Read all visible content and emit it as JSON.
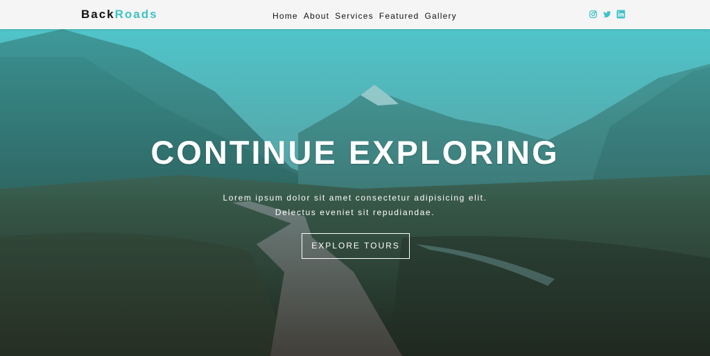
{
  "colors": {
    "accent": "#3ec1c8",
    "navbar_bg": "#f5f5f5",
    "text_dark": "#111111",
    "hero_text": "#ffffff"
  },
  "navbar": {
    "logo_part1": "Back",
    "logo_part2": "Roads",
    "links": [
      "Home",
      "About",
      "Services",
      "Featured",
      "Gallery"
    ],
    "social_icons": [
      "instagram-icon",
      "twitter-icon",
      "linkedin-icon"
    ]
  },
  "hero": {
    "title": "CONTINUE EXPLORING",
    "text_line1": "Lorem ipsum dolor sit amet consectetur adipisicing elit.",
    "text_line2": "Delectus eveniet sit repudiandae.",
    "button_label": "EXPLORE TOURS"
  }
}
